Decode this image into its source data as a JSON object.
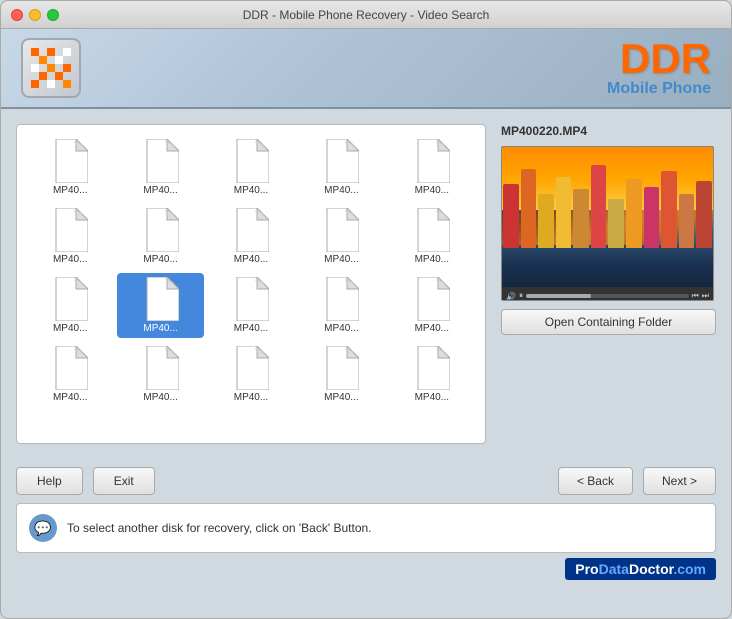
{
  "window": {
    "title": "DDR - Mobile Phone Recovery - Video Search"
  },
  "header": {
    "brand_ddr": "DDR",
    "brand_sub": "Mobile Phone",
    "logo_alt": "DDR Logo"
  },
  "preview": {
    "filename": "MP400220.MP4",
    "open_folder_btn": "Open Containing Folder"
  },
  "files": [
    {
      "label": "MP40...",
      "selected": false
    },
    {
      "label": "MP40...",
      "selected": false
    },
    {
      "label": "MP40...",
      "selected": false
    },
    {
      "label": "MP40...",
      "selected": false
    },
    {
      "label": "MP40...",
      "selected": false
    },
    {
      "label": "MP40...",
      "selected": false
    },
    {
      "label": "MP40...",
      "selected": false
    },
    {
      "label": "MP40...",
      "selected": false
    },
    {
      "label": "MP40...",
      "selected": false
    },
    {
      "label": "MP40...",
      "selected": false
    },
    {
      "label": "MP40...",
      "selected": false
    },
    {
      "label": "MP40...",
      "selected": true
    },
    {
      "label": "MP40...",
      "selected": false
    },
    {
      "label": "MP40...",
      "selected": false
    },
    {
      "label": "MP40...",
      "selected": false
    },
    {
      "label": "MP40...",
      "selected": false
    },
    {
      "label": "MP40...",
      "selected": false
    },
    {
      "label": "MP40...",
      "selected": false
    },
    {
      "label": "MP40...",
      "selected": false
    },
    {
      "label": "MP40...",
      "selected": false
    }
  ],
  "buttons": {
    "help": "Help",
    "exit": "Exit",
    "back": "< Back",
    "next": "Next >"
  },
  "status": {
    "message": "To select another disk for recovery, click on 'Back' Button."
  },
  "footer": {
    "brand": "ProDataDoctor.com"
  },
  "colors": {
    "selected_blue": "#4488dd",
    "brand_orange": "#ff6600",
    "brand_blue": "#4488cc",
    "footer_blue": "#003388"
  }
}
